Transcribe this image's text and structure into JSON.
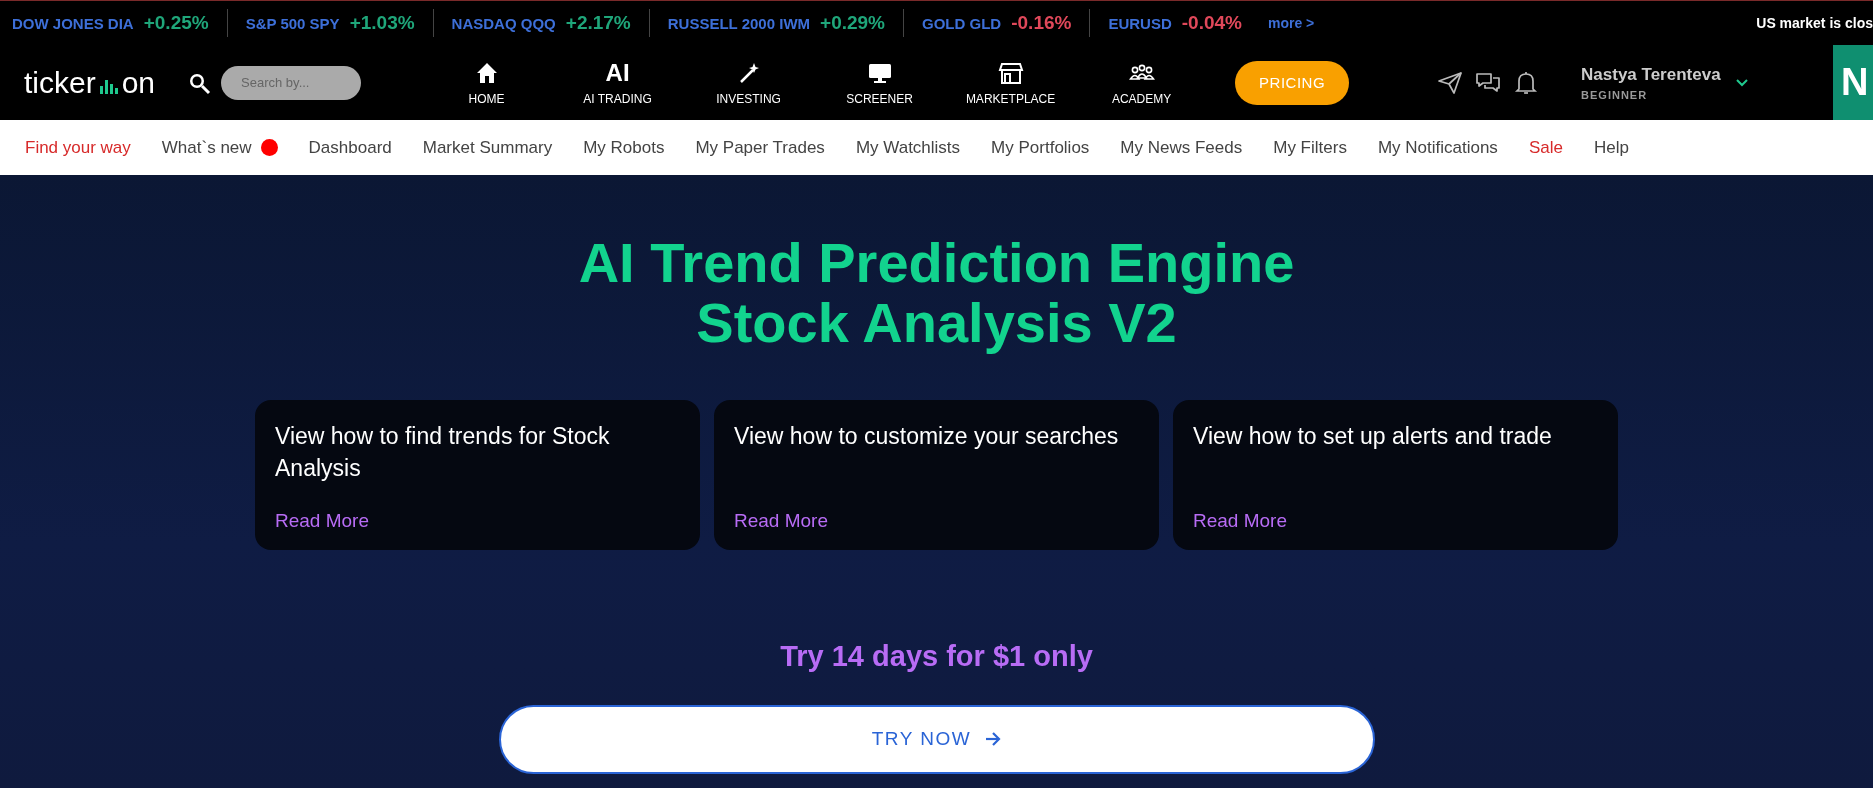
{
  "ticker": {
    "items": [
      {
        "name": "DOW JONES DIA",
        "change": "+0.25%",
        "color": "#1fa67a"
      },
      {
        "name": "S&P 500 SPY",
        "change": "+1.03%",
        "color": "#1fa67a"
      },
      {
        "name": "NASDAQ QQQ",
        "change": "+2.17%",
        "color": "#1fa67a"
      },
      {
        "name": "RUSSELL 2000 IWM",
        "change": "+0.29%",
        "color": "#1fa67a"
      },
      {
        "name": "GOLD GLD",
        "change": "-0.16%",
        "color": "#e0485a"
      },
      {
        "name": "EURUSD",
        "change": "-0.04%",
        "color": "#e0485a"
      }
    ],
    "more": "more >",
    "status": "US market is clos"
  },
  "header": {
    "logo": {
      "left": "ticker",
      "right": "on"
    },
    "search": {
      "placeholder": "Search by..."
    },
    "nav": [
      {
        "label": "HOME"
      },
      {
        "icon_text": "AI",
        "label": "AI TRADING"
      },
      {
        "label": "INVESTING"
      },
      {
        "label": "SCREENER"
      },
      {
        "label": "MARKETPLACE"
      },
      {
        "label": "ACADEMY"
      }
    ],
    "pricing": "PRICING",
    "user": {
      "name": "Nastya Terenteva",
      "level": "BEGINNER",
      "avatar": "N"
    }
  },
  "menu": [
    {
      "label": "Find your way",
      "highlighted": true,
      "dot": false
    },
    {
      "label": "What`s new",
      "highlighted": false,
      "dot": true
    },
    {
      "label": "Dashboard",
      "highlighted": false,
      "dot": false
    },
    {
      "label": "Market Summary",
      "highlighted": false,
      "dot": false
    },
    {
      "label": "My Robots",
      "highlighted": false,
      "dot": false
    },
    {
      "label": "My Paper Trades",
      "highlighted": false,
      "dot": false
    },
    {
      "label": "My Watchlists",
      "highlighted": false,
      "dot": false
    },
    {
      "label": "My Portfolios",
      "highlighted": false,
      "dot": false
    },
    {
      "label": "My News Feeds",
      "highlighted": false,
      "dot": false
    },
    {
      "label": "My Filters",
      "highlighted": false,
      "dot": false
    },
    {
      "label": "My Notifications",
      "highlighted": false,
      "dot": false
    },
    {
      "label": "Sale",
      "highlighted": true,
      "dot": false
    },
    {
      "label": "Help",
      "highlighted": false,
      "dot": false
    }
  ],
  "hero": {
    "title": [
      "AI Trend Prediction Engine",
      "Stock Analysis V2"
    ],
    "cards": [
      {
        "text": "View how to find trends for Stock Analysis",
        "link": "Read More"
      },
      {
        "text": "View how to customize your searches",
        "link": "Read More"
      },
      {
        "text": "View how to set up alerts and trade",
        "link": "Read More"
      }
    ],
    "offer": "Try 14 days for $1 only",
    "button": "TRY NOW"
  }
}
